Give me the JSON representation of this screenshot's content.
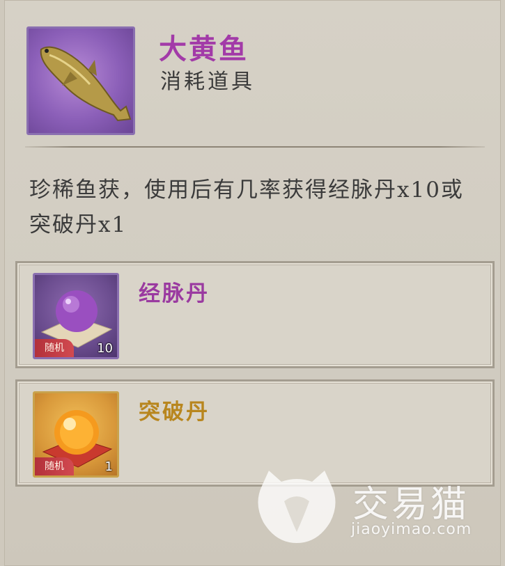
{
  "item": {
    "name": "大黄鱼",
    "type": "消耗道具",
    "icon": "yellow-croaker-fish-icon",
    "rarity_color": "#a23aa8",
    "description": "珍稀鱼获，使用后有几率获得经脉丹x10或突破丹x1"
  },
  "rewards": [
    {
      "name": "经脉丹",
      "icon": "purple-pill-orb-icon",
      "tag": "随机",
      "quantity": "10",
      "name_color": "#9a3aa0"
    },
    {
      "name": "突破丹",
      "icon": "orange-pill-orb-icon",
      "tag": "随机",
      "quantity": "1",
      "name_color": "#b8861e"
    }
  ],
  "watermark": {
    "brand": "交易猫",
    "url": "jiaoyimao.com",
    "icon": "cat-logo-icon"
  }
}
